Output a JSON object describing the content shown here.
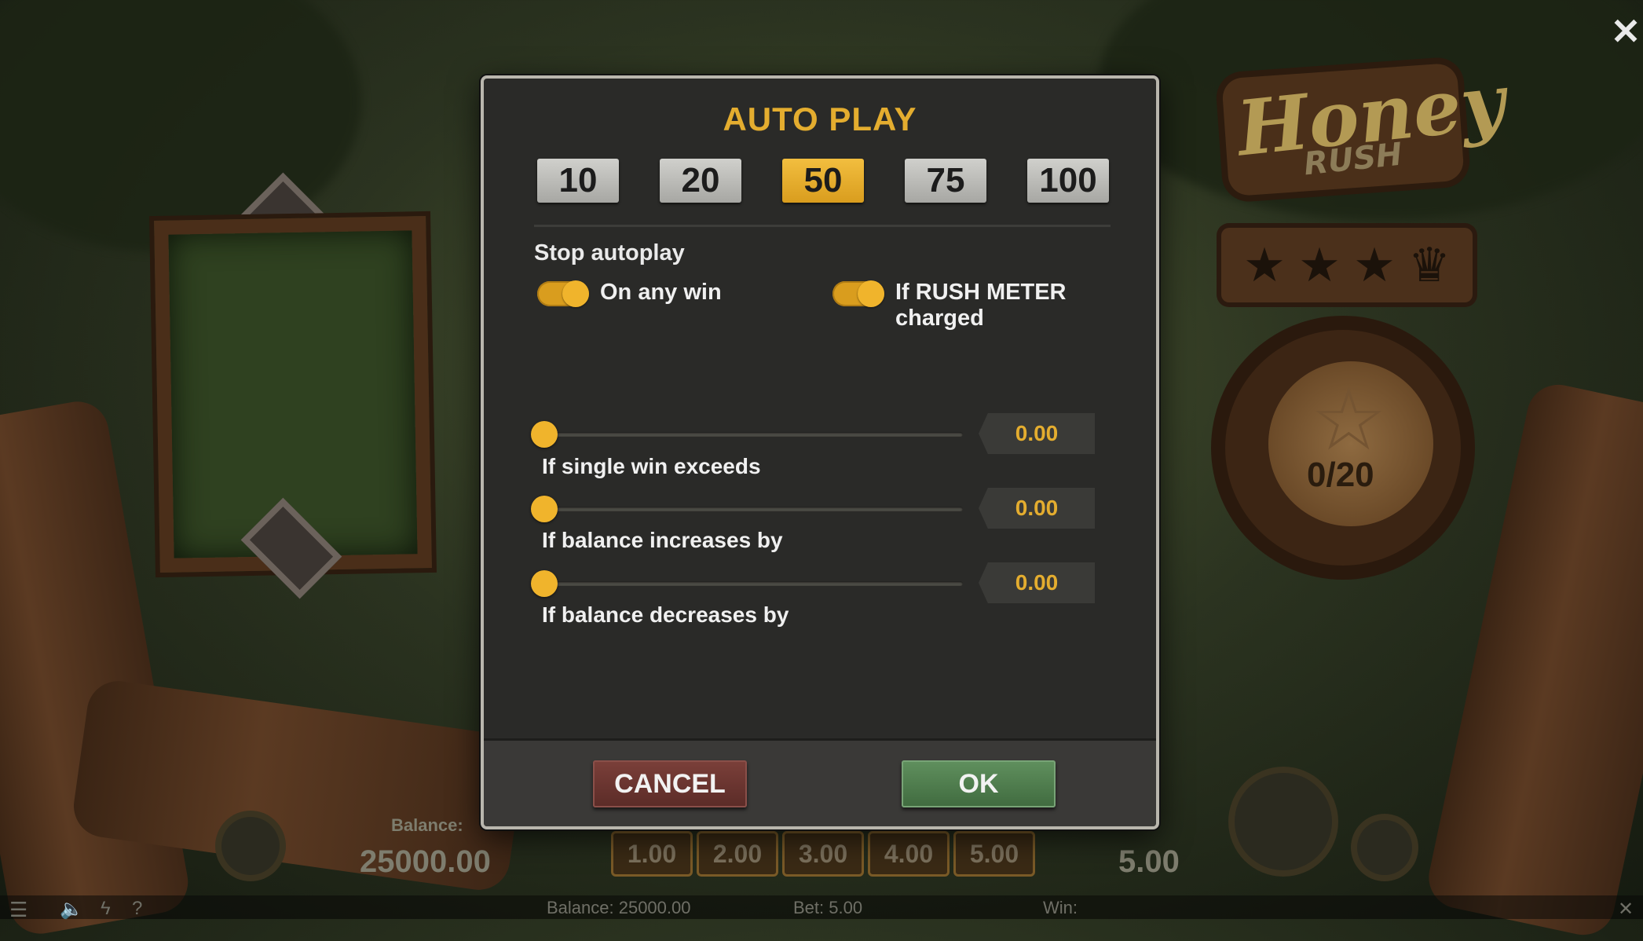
{
  "dialog": {
    "title": "AUTO PLAY",
    "presets": [
      "10",
      "20",
      "50",
      "75",
      "100"
    ],
    "active_preset": "50",
    "stop_label": "Stop autoplay",
    "toggles": [
      {
        "label": "On any win",
        "on": true
      },
      {
        "label": "If RUSH METER charged",
        "on": true
      }
    ],
    "sliders": [
      {
        "label": "If single win exceeds",
        "value": "0.00",
        "level": 0
      },
      {
        "label": "If balance increases by",
        "value": "0.00",
        "level": 0
      },
      {
        "label": "If balance decreases by",
        "value": "0.00",
        "level": 0
      }
    ],
    "cancel_label": "CANCEL",
    "ok_label": "OK"
  },
  "game": {
    "logo_word1": "Honey",
    "logo_word2": "RUSH",
    "rush_meter": "0/20",
    "balance_label": "Balance:",
    "balance_value": "25000.00",
    "bet_options": [
      "1.00",
      "2.00",
      "3.00",
      "4.00",
      "5.00"
    ],
    "bet_value": "5.00"
  },
  "status_bar": {
    "balance": "Balance: 25000.00",
    "bet": "Bet: 5.00",
    "win": "Win:"
  },
  "icons": {
    "close": "close-icon",
    "menu": "menu-icon",
    "sound": "speaker-icon",
    "turbo": "lightning-icon",
    "help": "help-icon"
  },
  "colors": {
    "accent": "#e4ad2f",
    "cancel": "#6b3530",
    "ok": "#4f7d4d",
    "panel": "#2a2a28"
  }
}
